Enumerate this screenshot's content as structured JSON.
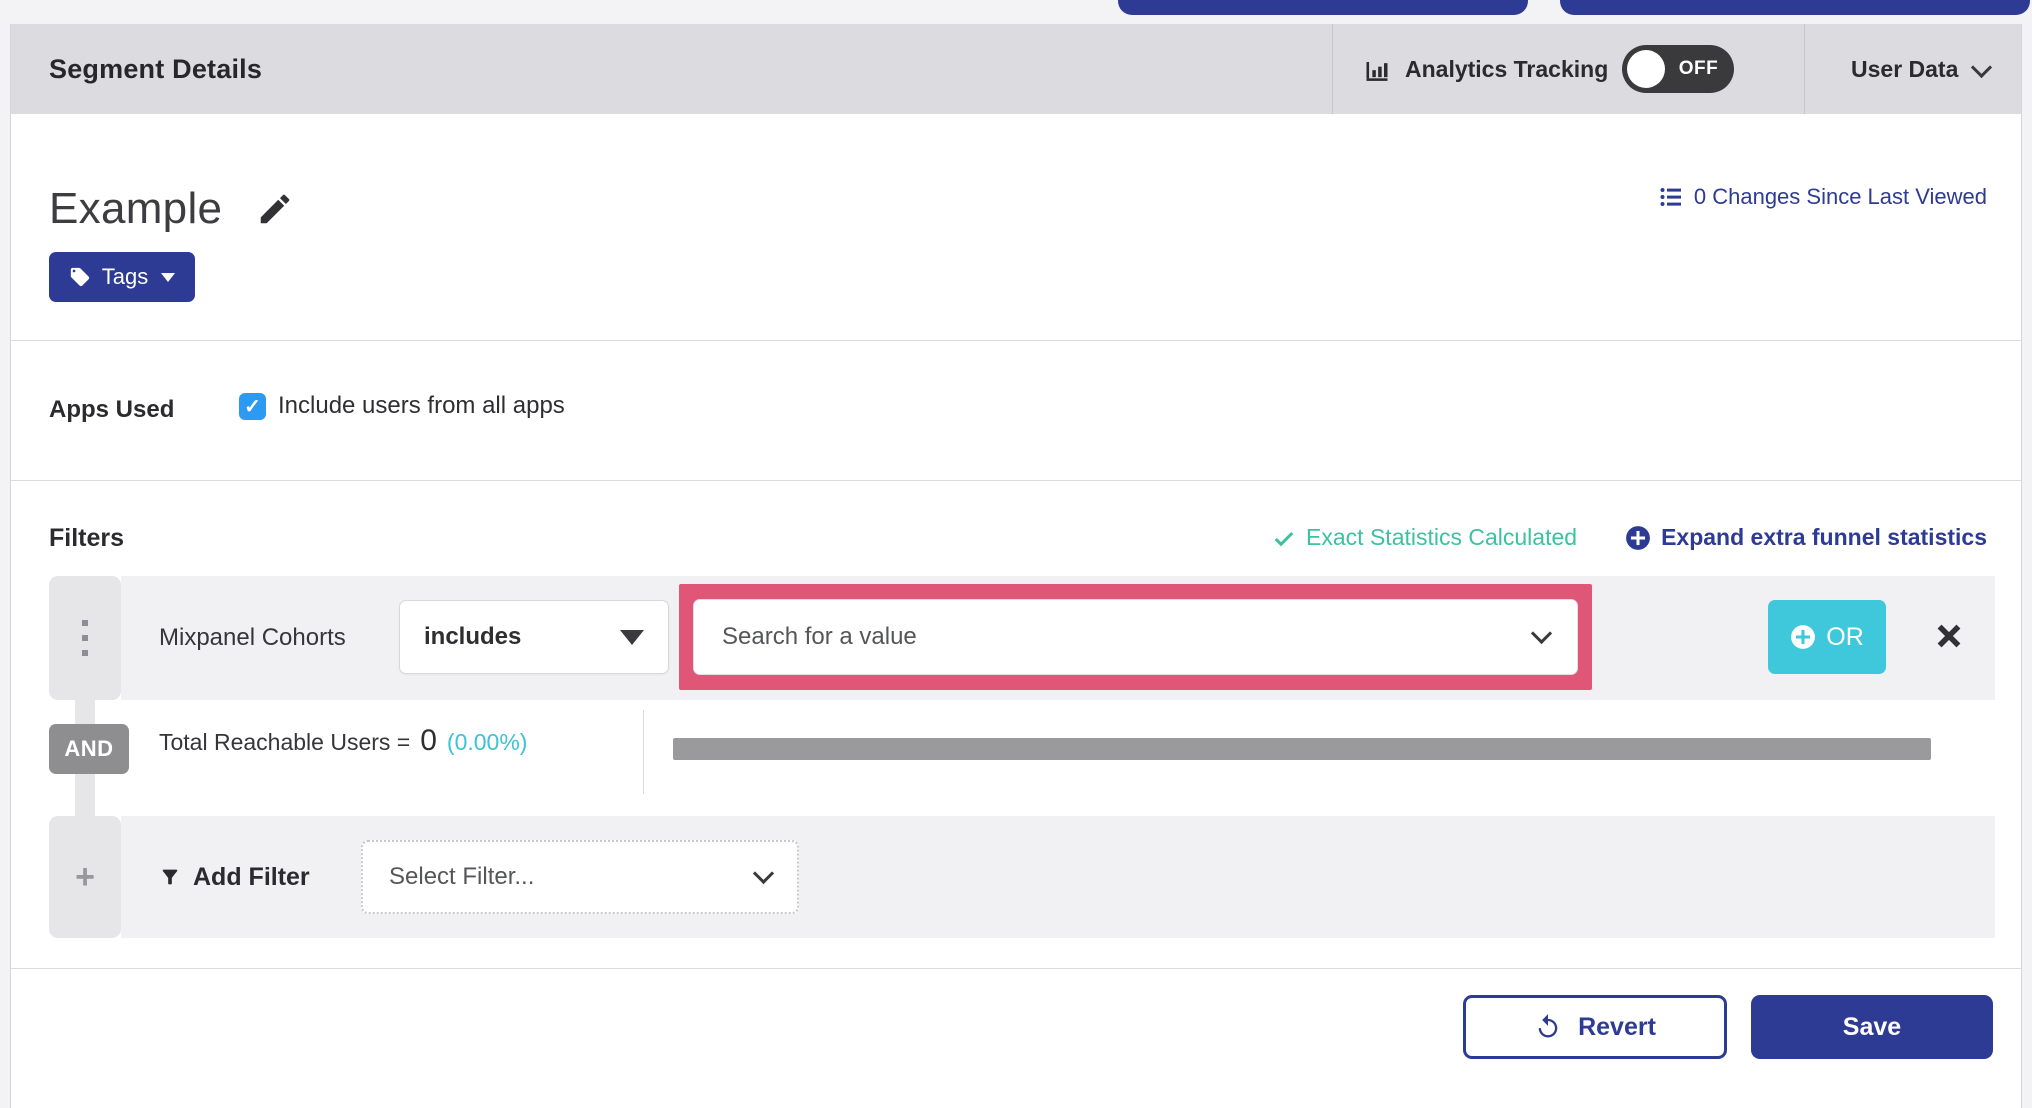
{
  "header": {
    "title": "Segment Details",
    "analytics_tracking_label": "Analytics Tracking",
    "toggle_state": "OFF",
    "user_data_label": "User Data"
  },
  "segment": {
    "name": "Example",
    "tags_label": "Tags",
    "changes_link": "0 Changes Since Last Viewed"
  },
  "apps_used": {
    "label": "Apps Used",
    "checkbox_checked": true,
    "checkbox_glyph": "✓",
    "checkbox_label": "Include users from all apps"
  },
  "filters": {
    "heading": "Filters",
    "exact_stats_label": "Exact Statistics Calculated",
    "expand_link_label": "Expand extra funnel statistics",
    "filter_row": {
      "name": "Mixpanel Cohorts",
      "operator": "includes",
      "value_placeholder": "Search for a value",
      "or_label": "OR"
    },
    "and_label": "AND",
    "total_reachable": {
      "label": "Total Reachable Users =",
      "value": "0",
      "percent": "(0.00%)"
    },
    "add_filter": {
      "label": "Add Filter",
      "select_placeholder": "Select Filter...",
      "plus_glyph": "+"
    }
  },
  "footer": {
    "revert_label": "Revert",
    "save_label": "Save"
  },
  "colors": {
    "brand_blue": "#2e3b94",
    "cyan_accent": "#3fc8dc",
    "teal_success": "#3cc29f",
    "pink_highlight": "#e05677",
    "checkbox_blue": "#2b9af0",
    "topbar_gray": "#dcdce0",
    "row_gray": "#f1f1f3",
    "progress_gray": "#9a9a9c"
  }
}
